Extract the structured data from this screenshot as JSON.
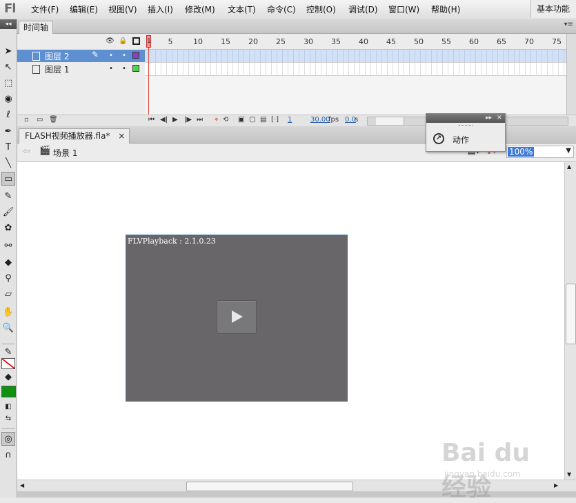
{
  "app": {
    "logo": "Fl",
    "workspace": "基本功能",
    "menu": [
      "文件(F)",
      "编辑(E)",
      "视图(V)",
      "插入(I)",
      "修改(M)",
      "文本(T)",
      "命令(C)",
      "控制(O)",
      "调试(D)",
      "窗口(W)",
      "帮助(H)"
    ]
  },
  "toolbox": {
    "collapse_glyph": "◂◂",
    "tools": [
      {
        "name": "selection-tool-icon",
        "glyph": "➤"
      },
      {
        "name": "subselection-tool-icon",
        "glyph": "↖"
      },
      {
        "name": "free-transform-tool-icon",
        "glyph": "⬚"
      },
      {
        "name": "3d-rotation-tool-icon",
        "glyph": "◉"
      },
      {
        "name": "lasso-tool-icon",
        "glyph": "ℓ"
      },
      {
        "name": "pen-tool-icon",
        "glyph": "✒"
      },
      {
        "name": "text-tool-icon",
        "glyph": "T"
      },
      {
        "name": "line-tool-icon",
        "glyph": "╲"
      },
      {
        "name": "rectangle-tool-icon",
        "glyph": "▭"
      },
      {
        "name": "pencil-tool-icon",
        "glyph": "✎"
      },
      {
        "name": "brush-tool-icon",
        "glyph": "🖌"
      },
      {
        "name": "deco-tool-icon",
        "glyph": "✿"
      },
      {
        "name": "bone-tool-icon",
        "glyph": "⚯"
      },
      {
        "name": "paint-bucket-tool-icon",
        "glyph": "◆"
      },
      {
        "name": "eyedropper-tool-icon",
        "glyph": "⚲"
      },
      {
        "name": "eraser-tool-icon",
        "glyph": "▱"
      },
      {
        "name": "hand-tool-icon",
        "glyph": "✋"
      },
      {
        "name": "zoom-tool-icon",
        "glyph": "🔍"
      }
    ],
    "stroke_color": "#ff0000",
    "fill_color": "#109010"
  },
  "timeline": {
    "tab_label": "时间轴",
    "menu_glyph": "▾≡",
    "ruler": [
      1,
      5,
      10,
      15,
      20,
      25,
      30,
      35,
      40,
      45,
      50,
      55,
      60,
      65,
      70,
      75
    ],
    "layers": [
      {
        "name": "图层 2",
        "selected": true,
        "outline_color": "#8b3fb8"
      },
      {
        "name": "图层 1",
        "selected": false,
        "outline_color": "#4fd34f"
      }
    ],
    "controls": {
      "current_frame": "1",
      "fps": "30.00",
      "fps_unit": "fps",
      "time": "0.0",
      "time_unit": "s"
    }
  },
  "document": {
    "tab_label": "FLASH视频播放器.fla*",
    "close_glyph": "×",
    "scene": "场景 1",
    "zoom": "100%"
  },
  "stage": {
    "component_label": "FLVPlayback : 2.1.0.23"
  },
  "actions_panel": {
    "label": "动作"
  },
  "watermark": {
    "brand": "Bai du 经验",
    "sub": "jingyan.baidu.com"
  }
}
